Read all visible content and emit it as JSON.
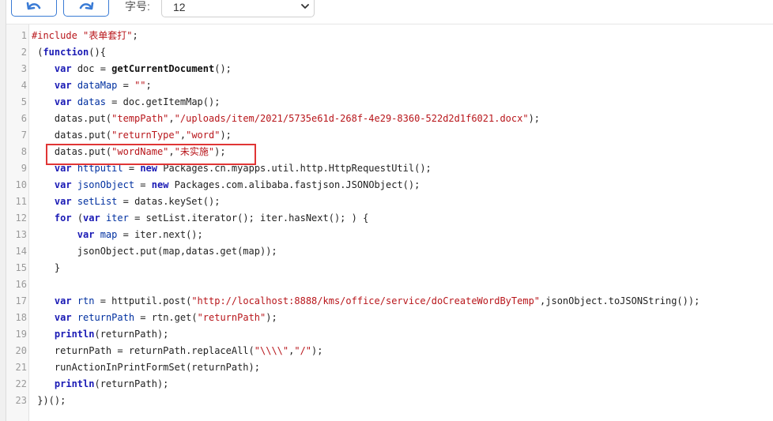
{
  "toolbar": {
    "font_size_label": "字号:",
    "font_size_value": "12"
  },
  "editor": {
    "lines": [
      {
        "n": "1",
        "tokens": [
          {
            "t": "pp",
            "v": "#include "
          },
          {
            "t": "str",
            "v": "\"表单套打\""
          },
          {
            "t": "p",
            "v": ";"
          }
        ]
      },
      {
        "n": "2",
        "tokens": [
          {
            "t": "p",
            "v": " ("
          },
          {
            "t": "kw",
            "v": "function"
          },
          {
            "t": "p",
            "v": "(){"
          }
        ]
      },
      {
        "n": "3",
        "tokens": [
          {
            "t": "p",
            "v": "    "
          },
          {
            "t": "kw",
            "v": "var"
          },
          {
            "t": "p",
            "v": " doc = "
          },
          {
            "t": "fn",
            "v": "getCurrentDocument"
          },
          {
            "t": "p",
            "v": "();"
          }
        ]
      },
      {
        "n": "4",
        "tokens": [
          {
            "t": "p",
            "v": "    "
          },
          {
            "t": "kw",
            "v": "var"
          },
          {
            "t": "vn",
            "v": " dataMap"
          },
          {
            "t": "p",
            "v": " = "
          },
          {
            "t": "str",
            "v": "\"\""
          },
          {
            "t": "p",
            "v": ";"
          }
        ]
      },
      {
        "n": "5",
        "tokens": [
          {
            "t": "p",
            "v": "    "
          },
          {
            "t": "kw",
            "v": "var"
          },
          {
            "t": "vn",
            "v": " datas"
          },
          {
            "t": "p",
            "v": " = doc.getItemMap();"
          }
        ]
      },
      {
        "n": "6",
        "tokens": [
          {
            "t": "p",
            "v": "    datas.put("
          },
          {
            "t": "str",
            "v": "\"tempPath\""
          },
          {
            "t": "p",
            "v": ","
          },
          {
            "t": "str",
            "v": "\"/uploads/item/2021/5735e61d-268f-4e29-8360-522d2d1f6021.docx\""
          },
          {
            "t": "p",
            "v": ");"
          }
        ]
      },
      {
        "n": "7",
        "tokens": [
          {
            "t": "p",
            "v": "    datas.put("
          },
          {
            "t": "str",
            "v": "\"returnType\""
          },
          {
            "t": "p",
            "v": ","
          },
          {
            "t": "str",
            "v": "\"word\""
          },
          {
            "t": "p",
            "v": ");"
          }
        ]
      },
      {
        "n": "8",
        "tokens": [
          {
            "t": "p",
            "v": "    datas.put("
          },
          {
            "t": "str",
            "v": "\"wordName\""
          },
          {
            "t": "p",
            "v": ","
          },
          {
            "t": "str",
            "v": "\"未实施\""
          },
          {
            "t": "p",
            "v": ");"
          }
        ]
      },
      {
        "n": "9",
        "tokens": [
          {
            "t": "p",
            "v": "    "
          },
          {
            "t": "kw",
            "v": "var"
          },
          {
            "t": "vn",
            "v": " httputil"
          },
          {
            "t": "p",
            "v": " = "
          },
          {
            "t": "kw",
            "v": "new"
          },
          {
            "t": "p",
            "v": " Packages.cn.myapps.util.http.HttpRequestUtil();"
          }
        ]
      },
      {
        "n": "10",
        "tokens": [
          {
            "t": "p",
            "v": "    "
          },
          {
            "t": "kw",
            "v": "var"
          },
          {
            "t": "vn",
            "v": " jsonObject"
          },
          {
            "t": "p",
            "v": " = "
          },
          {
            "t": "kw",
            "v": "new"
          },
          {
            "t": "p",
            "v": " Packages.com.alibaba.fastjson.JSONObject();"
          }
        ]
      },
      {
        "n": "11",
        "tokens": [
          {
            "t": "p",
            "v": "    "
          },
          {
            "t": "kw",
            "v": "var"
          },
          {
            "t": "vn",
            "v": " setList"
          },
          {
            "t": "p",
            "v": " = datas.keySet();"
          }
        ]
      },
      {
        "n": "12",
        "tokens": [
          {
            "t": "p",
            "v": "    "
          },
          {
            "t": "kw",
            "v": "for"
          },
          {
            "t": "p",
            "v": " ("
          },
          {
            "t": "kw",
            "v": "var"
          },
          {
            "t": "vn",
            "v": " iter"
          },
          {
            "t": "p",
            "v": " = setList.iterator(); iter.hasNext(); ) {"
          }
        ]
      },
      {
        "n": "13",
        "tokens": [
          {
            "t": "p",
            "v": "        "
          },
          {
            "t": "kw",
            "v": "var"
          },
          {
            "t": "vn",
            "v": " map"
          },
          {
            "t": "p",
            "v": " = iter.next();"
          }
        ]
      },
      {
        "n": "14",
        "tokens": [
          {
            "t": "p",
            "v": "        jsonObject.put(map,datas.get(map));"
          }
        ]
      },
      {
        "n": "15",
        "tokens": [
          {
            "t": "p",
            "v": "    }"
          }
        ]
      },
      {
        "n": "16",
        "tokens": [
          {
            "t": "p",
            "v": ""
          }
        ]
      },
      {
        "n": "17",
        "tokens": [
          {
            "t": "p",
            "v": "    "
          },
          {
            "t": "kw",
            "v": "var"
          },
          {
            "t": "vn",
            "v": " rtn"
          },
          {
            "t": "p",
            "v": " = httputil.post("
          },
          {
            "t": "str",
            "v": "\"http://localhost:8888/kms/office/service/doCreateWordByTemp\""
          },
          {
            "t": "p",
            "v": ",jsonObject.toJSONString());"
          }
        ]
      },
      {
        "n": "18",
        "tokens": [
          {
            "t": "p",
            "v": "    "
          },
          {
            "t": "kw",
            "v": "var"
          },
          {
            "t": "vn",
            "v": " returnPath"
          },
          {
            "t": "p",
            "v": " = rtn.get("
          },
          {
            "t": "str",
            "v": "\"returnPath\""
          },
          {
            "t": "p",
            "v": ");"
          }
        ]
      },
      {
        "n": "19",
        "tokens": [
          {
            "t": "p",
            "v": "    "
          },
          {
            "t": "kw",
            "v": "println"
          },
          {
            "t": "p",
            "v": "(returnPath);"
          }
        ]
      },
      {
        "n": "20",
        "tokens": [
          {
            "t": "p",
            "v": "    returnPath = returnPath.replaceAll("
          },
          {
            "t": "str",
            "v": "\"\\\\\\\\\""
          },
          {
            "t": "p",
            "v": ","
          },
          {
            "t": "str",
            "v": "\"/\""
          },
          {
            "t": "p",
            "v": ");"
          }
        ]
      },
      {
        "n": "21",
        "tokens": [
          {
            "t": "p",
            "v": "    runActionInPrintFormSet(returnPath);"
          }
        ]
      },
      {
        "n": "22",
        "tokens": [
          {
            "t": "p",
            "v": "    "
          },
          {
            "t": "kw",
            "v": "println"
          },
          {
            "t": "p",
            "v": "(returnPath);"
          }
        ]
      },
      {
        "n": "23",
        "tokens": [
          {
            "t": "p",
            "v": " })();"
          }
        ]
      }
    ]
  },
  "colors": {
    "accent": "#3a7bd5",
    "highlight_border": "#e03535"
  },
  "icons": {
    "undo": "undo-icon",
    "redo": "redo-icon",
    "caret": "chevron-down-icon"
  }
}
